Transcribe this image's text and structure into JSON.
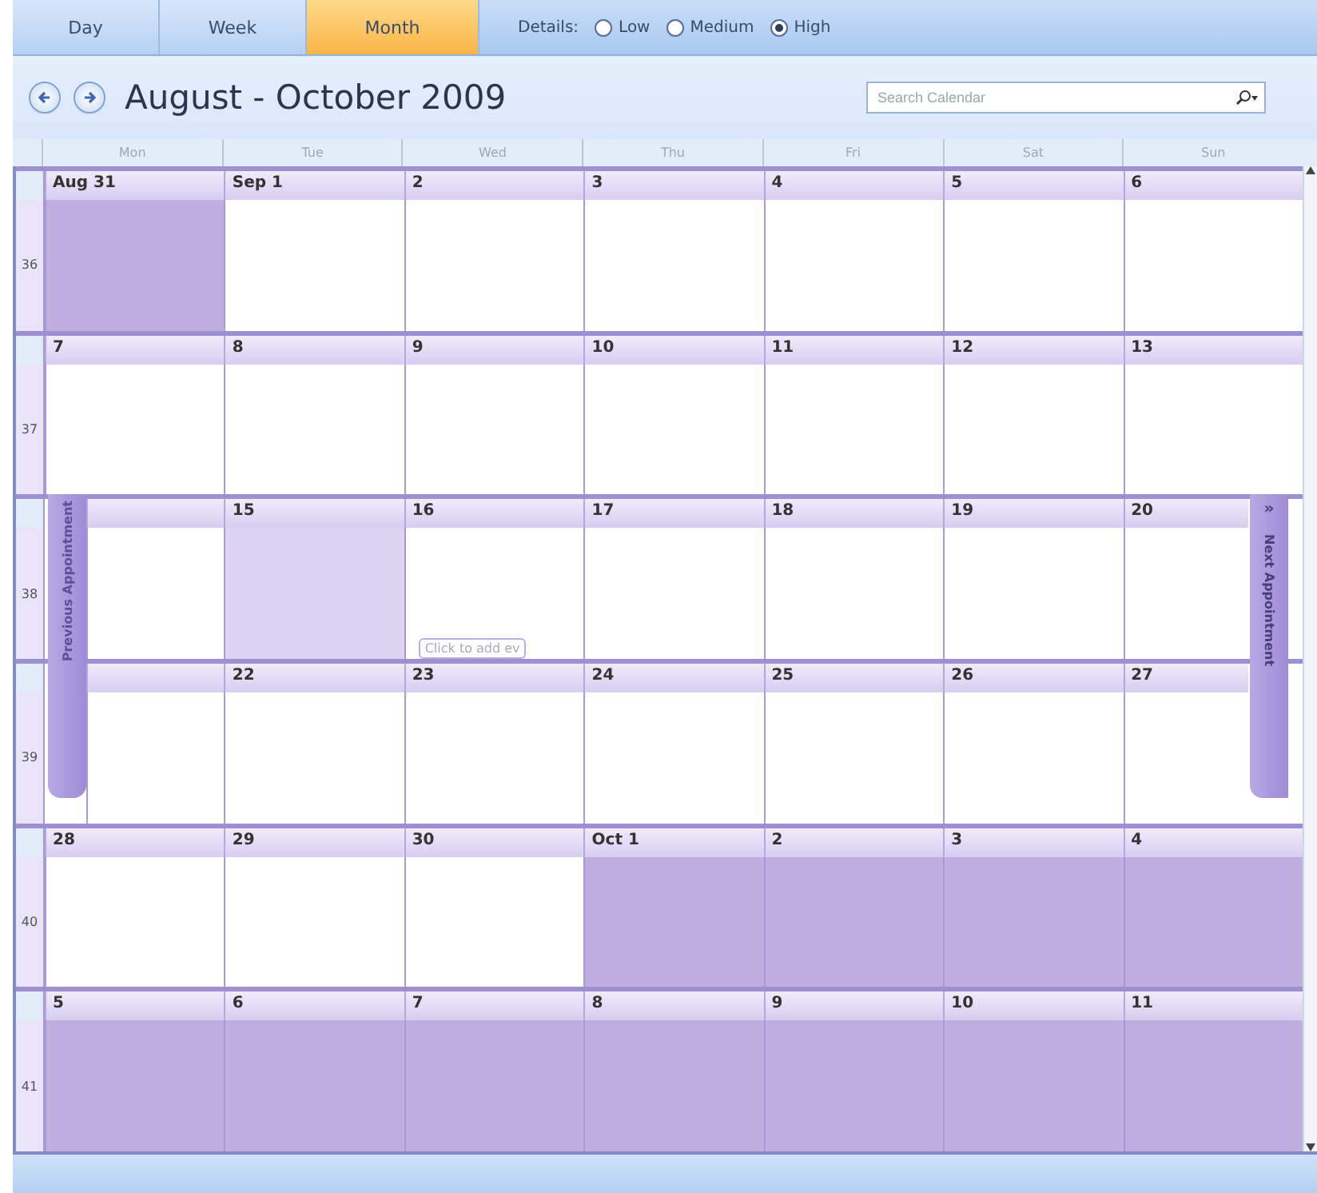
{
  "view_tabs": [
    {
      "label": "Day",
      "selected": false
    },
    {
      "label": "Week",
      "selected": false
    },
    {
      "label": "Month",
      "selected": true
    }
  ],
  "details": {
    "label": "Details:",
    "options": [
      {
        "label": "Low",
        "selected": false
      },
      {
        "label": "Medium",
        "selected": false
      },
      {
        "label": "High",
        "selected": true
      }
    ]
  },
  "title": "August - October 2009",
  "search": {
    "placeholder": "Search Calendar"
  },
  "day_names": [
    "Mon",
    "Tue",
    "Wed",
    "Thu",
    "Fri",
    "Sat",
    "Sun"
  ],
  "weeks": [
    {
      "number": "36",
      "days": [
        {
          "date": "Aug 31",
          "shaded": true,
          "selected": false
        },
        {
          "date": "Sep 1",
          "shaded": false,
          "selected": false
        },
        {
          "date": "2",
          "shaded": false,
          "selected": false
        },
        {
          "date": "3",
          "shaded": false,
          "selected": false
        },
        {
          "date": "4",
          "shaded": false,
          "selected": false
        },
        {
          "date": "5",
          "shaded": false,
          "selected": false
        },
        {
          "date": "6",
          "shaded": false,
          "selected": false
        }
      ]
    },
    {
      "number": "37",
      "days": [
        {
          "date": "7",
          "shaded": false,
          "selected": false
        },
        {
          "date": "8",
          "shaded": false,
          "selected": false
        },
        {
          "date": "9",
          "shaded": false,
          "selected": false
        },
        {
          "date": "10",
          "shaded": false,
          "selected": false
        },
        {
          "date": "11",
          "shaded": false,
          "selected": false
        },
        {
          "date": "12",
          "shaded": false,
          "selected": false
        },
        {
          "date": "13",
          "shaded": false,
          "selected": false
        }
      ]
    },
    {
      "number": "38",
      "days": [
        {
          "shaded": false,
          "selected": false
        },
        {
          "date": "15",
          "shaded": false,
          "selected": true
        },
        {
          "date": "16",
          "shaded": false,
          "selected": false,
          "hint": "Click to add ev"
        },
        {
          "date": "17",
          "shaded": false,
          "selected": false
        },
        {
          "date": "18",
          "shaded": false,
          "selected": false
        },
        {
          "date": "19",
          "shaded": false,
          "selected": false
        },
        {
          "date": "20",
          "shaded": false,
          "selected": false
        }
      ]
    },
    {
      "number": "39",
      "days": [
        {
          "shaded": false,
          "selected": false
        },
        {
          "date": "22",
          "shaded": false,
          "selected": false
        },
        {
          "date": "23",
          "shaded": false,
          "selected": false
        },
        {
          "date": "24",
          "shaded": false,
          "selected": false
        },
        {
          "date": "25",
          "shaded": false,
          "selected": false
        },
        {
          "date": "26",
          "shaded": false,
          "selected": false
        },
        {
          "date": "27",
          "shaded": false,
          "selected": false
        }
      ]
    },
    {
      "number": "40",
      "days": [
        {
          "date": "28",
          "shaded": false,
          "selected": false
        },
        {
          "date": "29",
          "shaded": false,
          "selected": false
        },
        {
          "date": "30",
          "shaded": false,
          "selected": false
        },
        {
          "date": "Oct 1",
          "shaded": true,
          "selected": false
        },
        {
          "date": "2",
          "shaded": true,
          "selected": false
        },
        {
          "date": "3",
          "shaded": true,
          "selected": false
        },
        {
          "date": "4",
          "shaded": true,
          "selected": false
        }
      ]
    },
    {
      "number": "41",
      "days": [
        {
          "date": "5",
          "shaded": true,
          "selected": false
        },
        {
          "date": "6",
          "shaded": true,
          "selected": false
        },
        {
          "date": "7",
          "shaded": true,
          "selected": false
        },
        {
          "date": "8",
          "shaded": true,
          "selected": false
        },
        {
          "date": "9",
          "shaded": true,
          "selected": false
        },
        {
          "date": "10",
          "shaded": true,
          "selected": false
        },
        {
          "date": "11",
          "shaded": true,
          "selected": false
        }
      ]
    }
  ],
  "previous_appointment": {
    "label": "Previous Appointment"
  },
  "next_appointment": {
    "label": "Next Appointment",
    "arrow": "»"
  }
}
